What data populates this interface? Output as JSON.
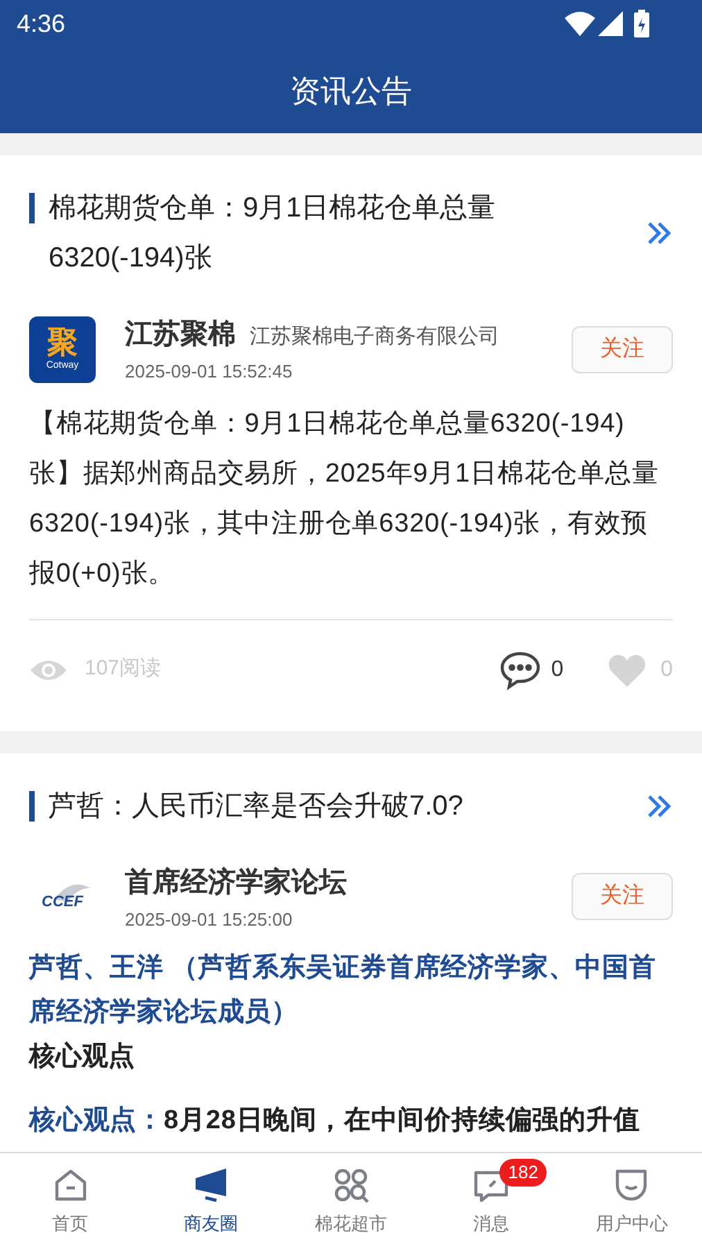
{
  "status_bar": {
    "time": "4:36"
  },
  "header": {
    "title": "资讯公告"
  },
  "posts": [
    {
      "title": "棉花期货仓单：9月1日棉花仓单总量6320(-194)张",
      "author": {
        "kind": "square",
        "logo_text": "聚",
        "logo_subtext": "Cotway",
        "name": "江苏聚棉",
        "company": "江苏聚棉电子商务有限公司",
        "time": "2025-09-01 15:52:45"
      },
      "follow_label": "关注",
      "paragraphs": [
        {
          "kind": "plain",
          "text": "【棉花期货仓单：9月1日棉花仓单总量6320(-194)张】据郑州商品交易所，2025年9月1日棉花仓单总量6320(-194)张，其中注册仓单6320(-194)张，有效预报0(+0)张。"
        }
      ],
      "stats": {
        "reads": "107阅读",
        "comments": "0",
        "likes": "0"
      }
    },
    {
      "title": "芦哲：人民币汇率是否会升破7.0?",
      "author": {
        "kind": "ccef",
        "logo_text": "CCEF",
        "name": "首席经济学家论坛",
        "time": "2025-09-01 15:25:00"
      },
      "follow_label": "关注",
      "paragraphs": [
        {
          "kind": "highlight",
          "text": "芦哲、王洋 （芦哲系东吴证券首席经济学家、中国首席经济学家论坛成员）"
        },
        {
          "kind": "heading",
          "text": "核心观点"
        },
        {
          "kind": "lead",
          "lead": "核心观点：",
          "text": "8月28日晚间，在中间价持续偏强的升值"
        }
      ]
    }
  ],
  "tabs": [
    {
      "label": "首页",
      "selected": false
    },
    {
      "label": "商友圈",
      "selected": true
    },
    {
      "label": "棉花超市",
      "selected": false
    },
    {
      "label": "消息",
      "selected": false,
      "badge": "182"
    },
    {
      "label": "用户中心",
      "selected": false
    }
  ]
}
